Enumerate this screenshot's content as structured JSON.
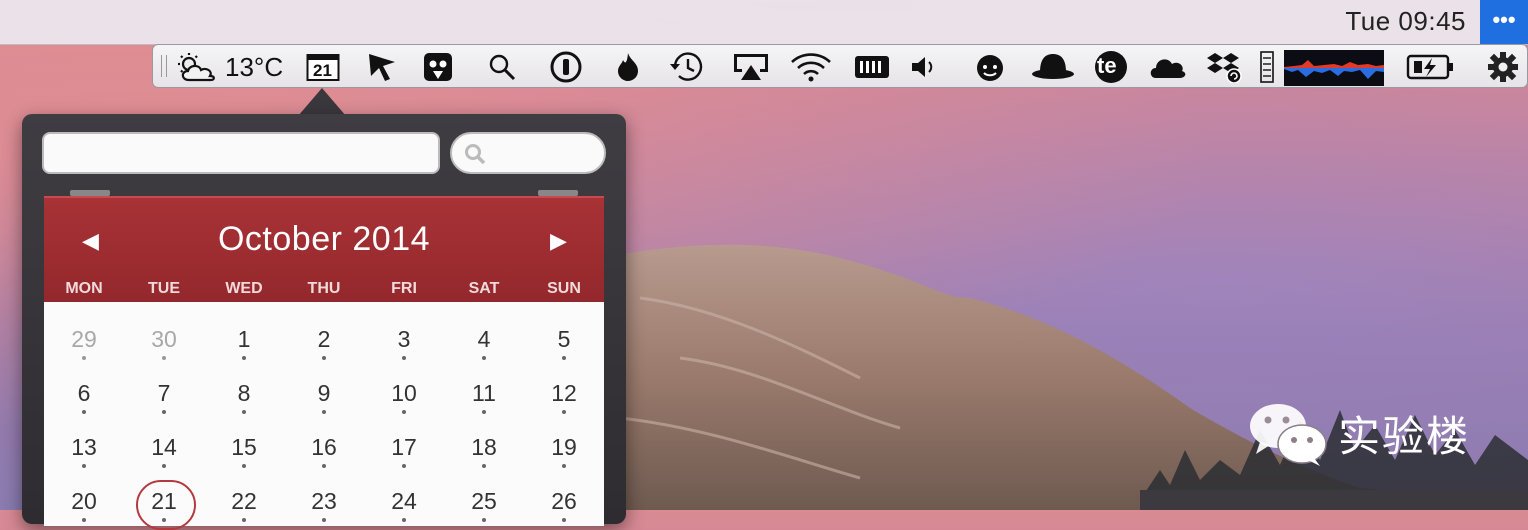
{
  "menubar": {
    "clock": "Tue 09:45",
    "more_label": "•••"
  },
  "statusbar": {
    "weather_temp": "13°C",
    "calendar_day": "21",
    "icons": [
      "weather-partly-cloudy-icon",
      "calendar-icon",
      "cursor-icon",
      "owl-icon",
      "search-icon",
      "onepassword-icon",
      "flame-icon",
      "time-machine-icon",
      "airplay-icon",
      "wifi-icon",
      "battery-meter-icon",
      "volume-icon",
      "face-icon",
      "hat-icon",
      "te-icon",
      "cloud-icon",
      "dropbox-icon",
      "memory-icon",
      "network-graph-icon",
      "battery-charging-icon",
      "gear-icon"
    ],
    "te_label": "te",
    "graph_colors": [
      "#e03a2b",
      "#2a6de0"
    ]
  },
  "popover": {
    "input_value": "",
    "search_placeholder": ""
  },
  "calendar": {
    "month_title": "October 2014",
    "prev_label": "◀",
    "next_label": "▶",
    "weekdays": [
      "MON",
      "TUE",
      "WED",
      "THU",
      "FRI",
      "SAT",
      "SUN"
    ],
    "weeks": [
      [
        "29",
        "30",
        "1",
        "2",
        "3",
        "4",
        "5"
      ],
      [
        "6",
        "7",
        "8",
        "9",
        "10",
        "11",
        "12"
      ],
      [
        "13",
        "14",
        "15",
        "16",
        "17",
        "18",
        "19"
      ],
      [
        "20",
        "21",
        "22",
        "23",
        "24",
        "25",
        "26"
      ]
    ],
    "other_month": [
      "29",
      "30"
    ],
    "today": "21",
    "header_color": "#a02e32"
  },
  "watermark": {
    "text": "实验楼"
  }
}
